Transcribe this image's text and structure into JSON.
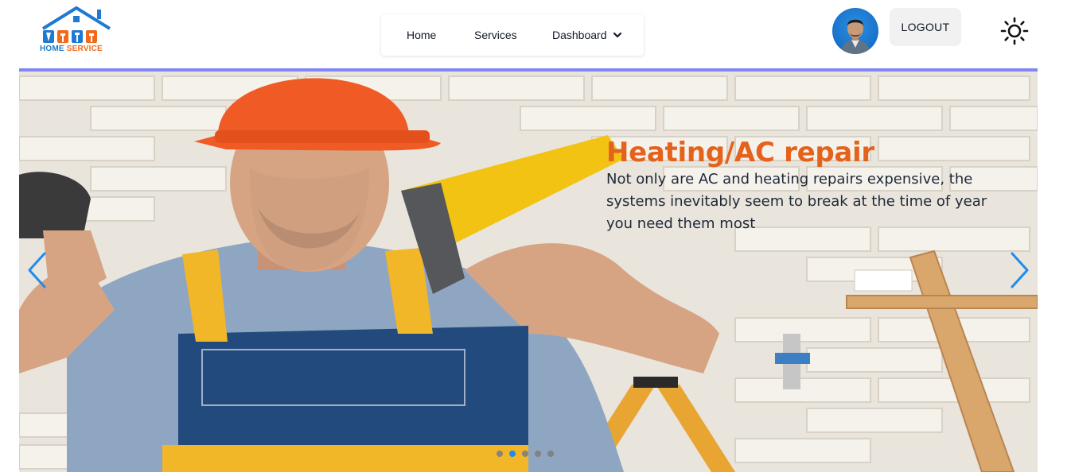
{
  "header": {
    "logo": {
      "text_main": "HOME",
      "text_accent": "SERVICE",
      "icon": "house-tools-logo-icon"
    },
    "nav": {
      "home_label": "Home",
      "services_label": "Services",
      "dashboard_label": "Dashboard",
      "dashboard_icon": "chevron-down-icon"
    },
    "avatar_icon": "user-avatar",
    "logout_label": "LOGOUT",
    "theme_icon": "sun-icon"
  },
  "slider": {
    "title": "Heating/AC repair",
    "description": "Not only are AC and heating repairs expensive, the systems inevitably seem to break at the time of year you need them most",
    "prev_icon": "chevron-left-icon",
    "next_icon": "chevron-right-icon",
    "slide_count": 5,
    "active_slide": 2
  },
  "colors": {
    "accent": "#8185f5",
    "title": "#e4621b",
    "arrow": "#1d8bf0",
    "logo_blue": "#1d7ad0",
    "logo_orange": "#ef6a1a"
  }
}
